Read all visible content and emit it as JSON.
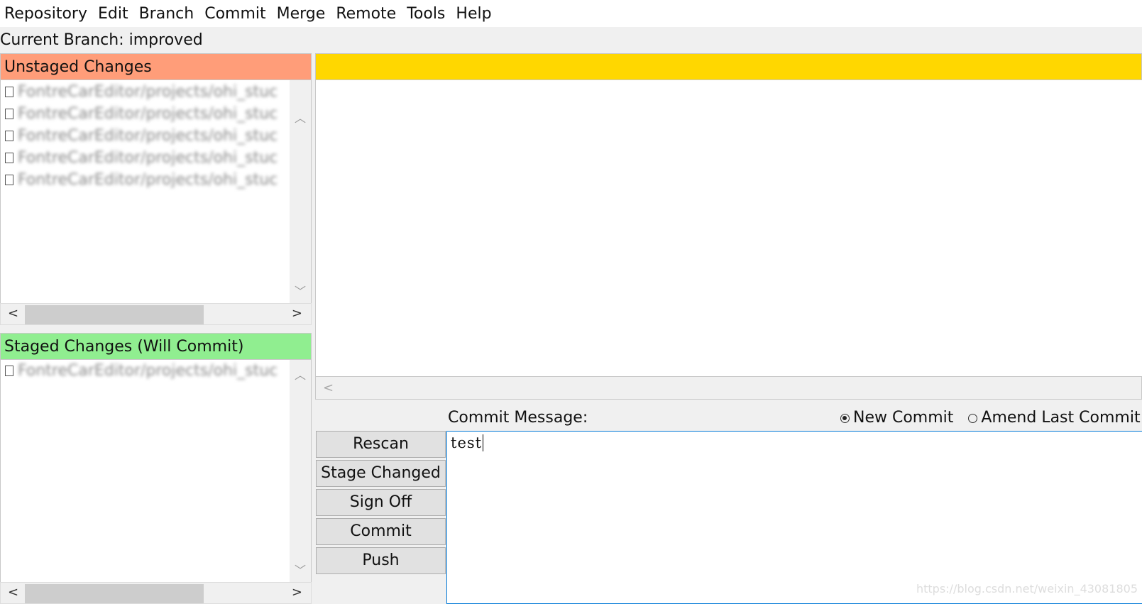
{
  "menu": [
    "Repository",
    "Edit",
    "Branch",
    "Commit",
    "Merge",
    "Remote",
    "Tools",
    "Help"
  ],
  "branch": {
    "label": "Current Branch:",
    "name": "improved"
  },
  "unstaged": {
    "title": "Unstaged Changes",
    "color": "#ff9d79",
    "files": [
      "FontreCarEditor/projects/ohi_stuc",
      "FontreCarEditor/projects/ohi_stuc",
      "FontreCarEditor/projects/ohi_stuc",
      "FontreCarEditor/projects/ohi_stuc",
      "FontreCarEditor/projects/ohi_stuc"
    ]
  },
  "staged": {
    "title": "Staged Changes (Will Commit)",
    "color": "#90ee90",
    "files": [
      "FontreCarEditor/projects/ohi_stuc"
    ]
  },
  "diff": {
    "header_color": "#ffd700"
  },
  "commit": {
    "label": "Commit Message:",
    "new_commit": "New Commit",
    "amend": "Amend Last Commit",
    "mode": "new",
    "message": "test"
  },
  "buttons": {
    "rescan": "Rescan",
    "stage_changed": "Stage Changed",
    "sign_off": "Sign Off",
    "commit": "Commit",
    "push": "Push"
  },
  "watermark": "https://blog.csdn.net/weixin_43081805"
}
